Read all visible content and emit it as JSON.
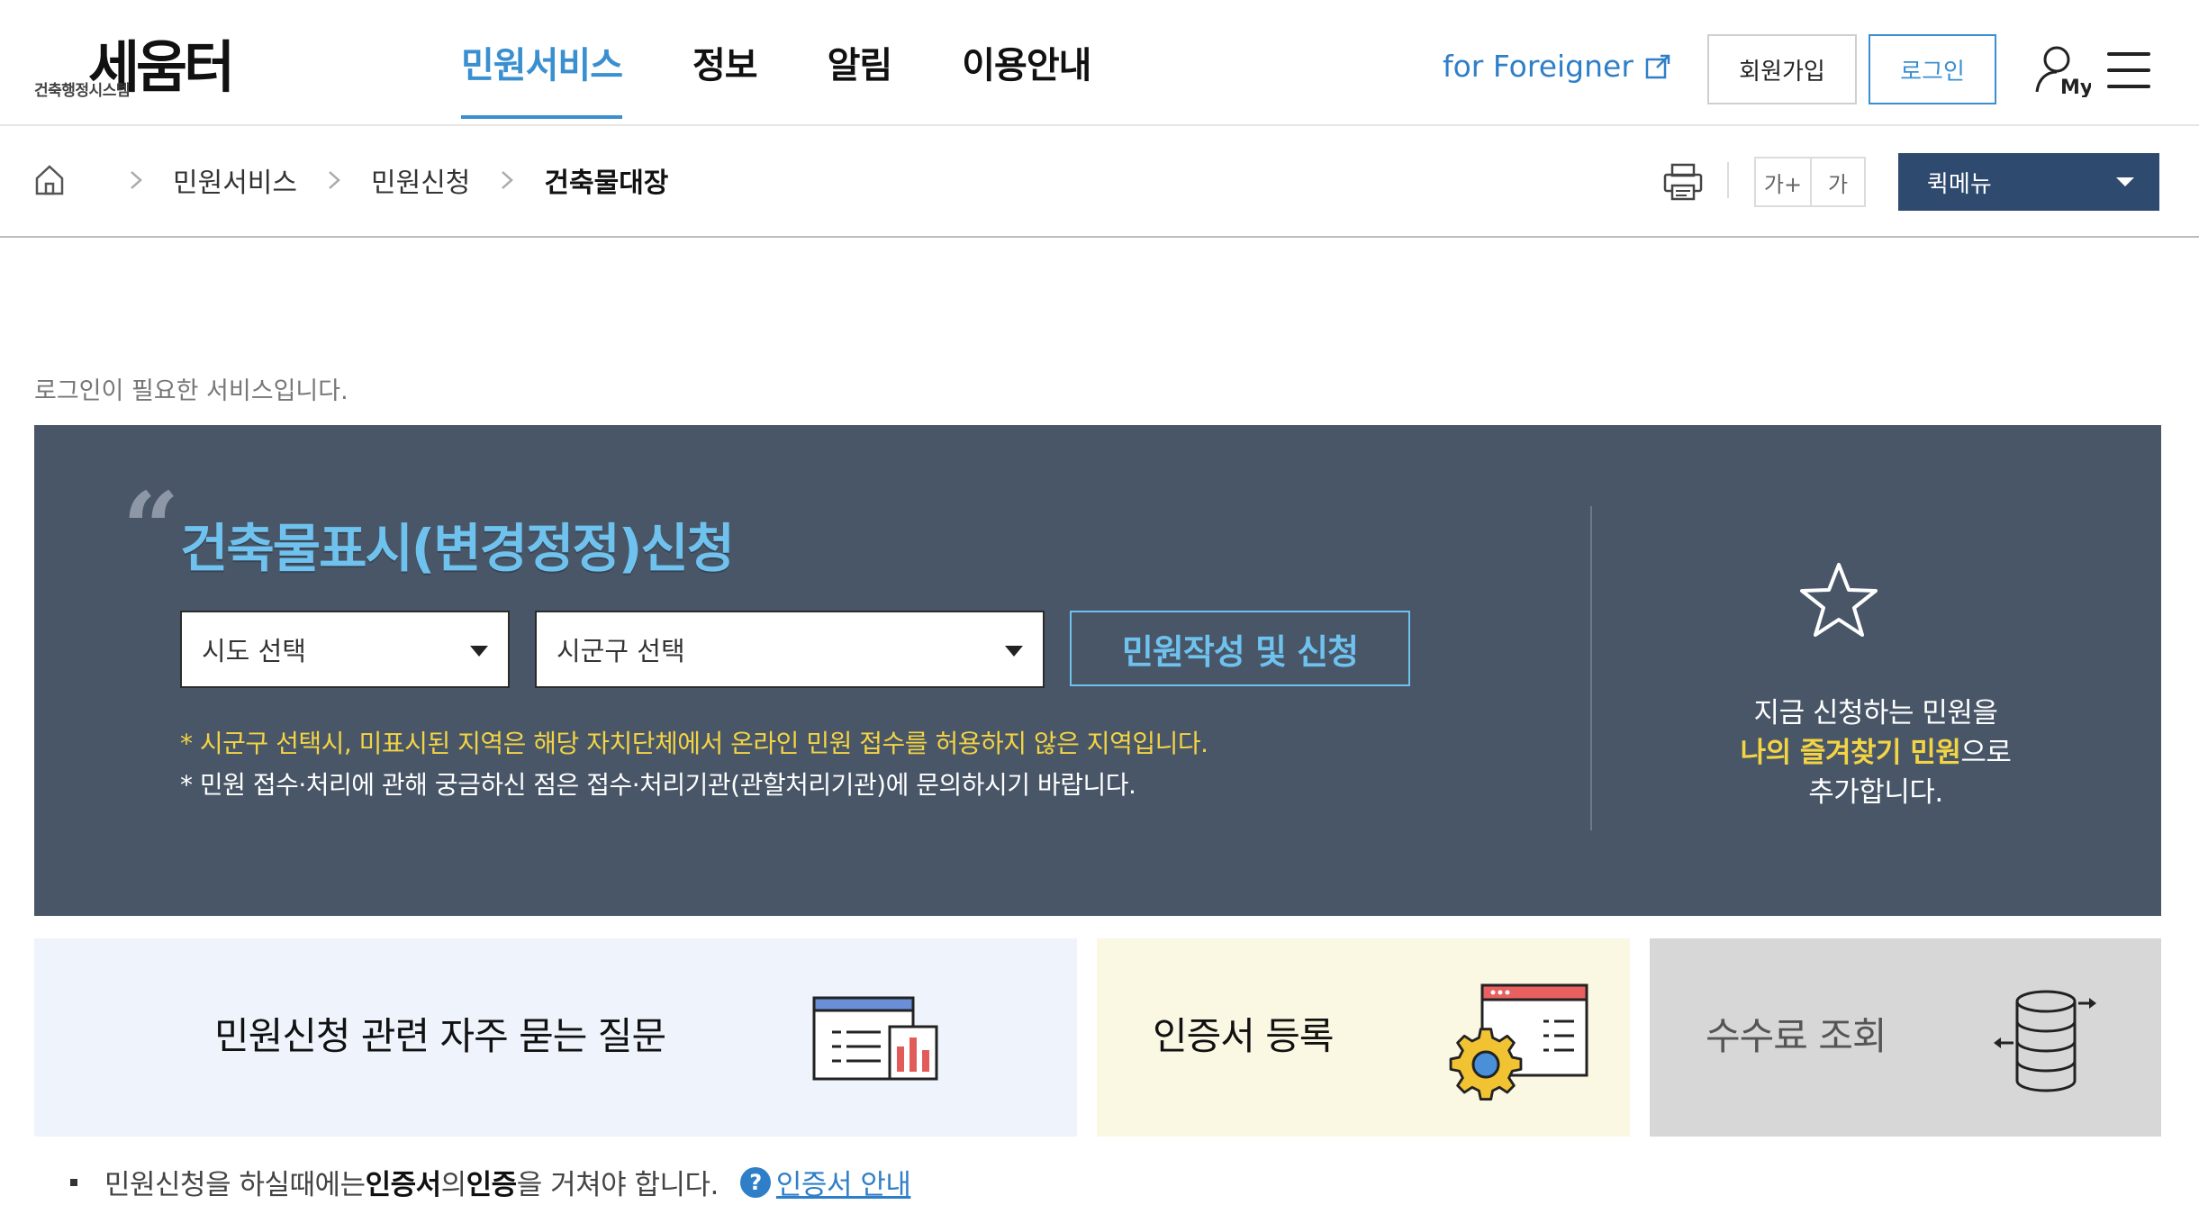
{
  "header": {
    "logo_main": "세움터",
    "logo_sub": "건축행정시스템",
    "nav": [
      "민원서비스",
      "정보",
      "알림",
      "이용안내"
    ],
    "foreigner_label": "for Foreigner",
    "join_label": "회원가입",
    "login_label": "로그인",
    "my_label": "My"
  },
  "breadcrumb": {
    "items": [
      "민원서비스",
      "민원신청",
      "건축물대장"
    ]
  },
  "utility": {
    "font_up": "가+",
    "font_default": "가",
    "quick_menu": "퀵메뉴"
  },
  "main": {
    "login_note": "로그인이 필요한 서비스입니다.",
    "title": "건축물표시(변경정정)신청",
    "sido_select": "시도 선택",
    "sigungu_select": "시군구 선택",
    "apply_button": "민원작성 및 신청",
    "note_yellow": "* 시군구 선택시, 미표시된 지역은 해당 자치단체에서 온라인 민원 접수를 허용하지 않은 지역입니다.",
    "note_white": "* 민원 접수·처리에 관해 궁금하신 점은 접수·처리기관(관할처리기관)에 문의하시기 바랍니다.",
    "fav_line1": "지금 신청하는 민원을",
    "fav_highlight": "나의 즐겨찾기 민원",
    "fav_suffix": "으로",
    "fav_line3": "추가합니다."
  },
  "cards": {
    "faq": "민원신청 관련 자주 묻는 질문",
    "cert": "인증서 등록",
    "fee": "수수료 조회"
  },
  "bottom": {
    "text_before": "민원신청을 하실때에는 ",
    "bold1": "인증서",
    "text_mid": "의 ",
    "bold2": "인증",
    "text_after": "을 거쳐야 합니다.",
    "help_glyph": "?",
    "link": "인증서 안내"
  },
  "colors": {
    "accent": "#3a8fd0",
    "panel_bg": "#485668",
    "title_blue": "#6fc2ee",
    "highlight_yellow": "#f4d443",
    "quick_bg": "#2e4a6e"
  }
}
